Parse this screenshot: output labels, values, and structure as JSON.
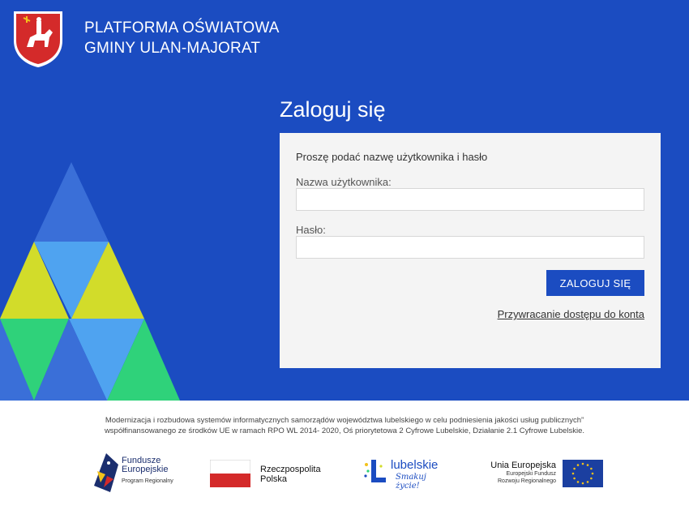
{
  "header": {
    "title_line1": "PLATFORMA OŚWIATOWA",
    "title_line2": "GMINY ULAN-MAJORAT",
    "crest_icon": "coat-of-arms-icon"
  },
  "login": {
    "title": "Zaloguj się",
    "prompt": "Proszę podać nazwę użytkownika i hasło",
    "username_label": "Nazwa użytkownika:",
    "username_value": "",
    "password_label": "Hasło:",
    "password_value": "",
    "submit_label": "ZALOGUJ SIĘ",
    "recover_link": "Przywracanie dostępu do konta"
  },
  "footer": {
    "note_line1": "Modernizacja i rozbudowa systemów informatycznych samorządów województwa lubelskiego w celu podniesienia jakości usług publicznych”",
    "note_line2": "współfinansowanego ze środków UE w ramach RPO WL 2014- 2020, Oś priorytetowa 2 Cyfrowe Lubelskie, Działanie 2.1 Cyfrowe Lubelskie.",
    "logos": {
      "fe_name1": "Fundusze",
      "fe_name2": "Europejskie",
      "fe_sub": "Program Regionalny",
      "rp_name1": "Rzeczpospolita",
      "rp_name2": "Polska",
      "lub_name": "lubelskie",
      "lub_slogan": "Smakuj życie!",
      "ue_name": "Unia Europejska",
      "ue_sub1": "Europejski Fundusz",
      "ue_sub2": "Rozwoju Regionalnego"
    }
  },
  "colors": {
    "brand_blue": "#1b4cc1",
    "triangle_yellow": "#d2dc2a",
    "triangle_green": "#2fd27a",
    "triangle_light_blue": "#4fa3f0",
    "card_bg": "#f4f4f4"
  }
}
